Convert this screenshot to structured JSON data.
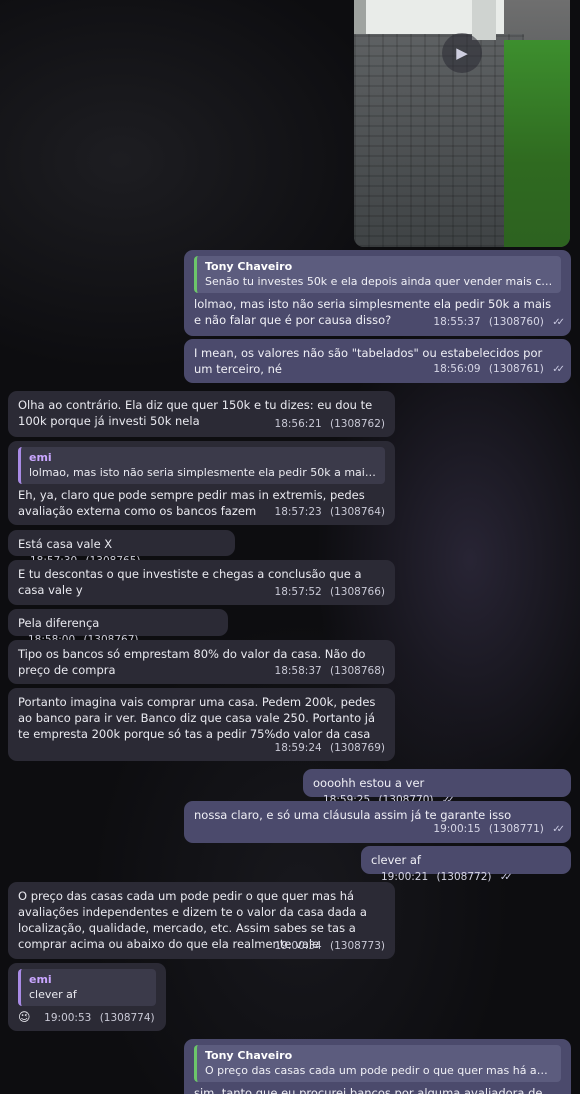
{
  "messages": [
    {
      "type": "out",
      "reply": {
        "author": "Tony Chaveiro",
        "text": "Senão tu investes 50k e ela depois ainda quer vender mais car..."
      },
      "text": "lolmao, mas isto não seria simplesmente ela pedir 50k a mais e não falar que é por causa disso?",
      "time": "18:55:37",
      "id": "(1308760)"
    },
    {
      "type": "out",
      "text": "I mean, os valores não são \"tabelados\" ou estabelecidos por um terceiro, né",
      "time": "18:56:09",
      "id": "(1308761)"
    },
    {
      "type": "in",
      "text": "Olha ao contrário. Ela diz que quer 150k e tu dizes: eu dou te 100k porque já investi 50k nela",
      "time": "18:56:21",
      "id": "(1308762)"
    },
    {
      "type": "in",
      "reply": {
        "author": "emi",
        "text": "lolmao, mas isto não seria simplesmente ela pedir 50k a mais e ..."
      },
      "text": "Eh, ya, claro que pode sempre pedir mas in extremis, pedes avaliação externa como os bancos fazem",
      "time": "18:57:23",
      "id": "(1308764)"
    },
    {
      "type": "in",
      "text": "Está casa vale X",
      "time": "18:57:30",
      "id": "(1308765)"
    },
    {
      "type": "in",
      "text": "E tu descontas o que investiste e chegas a conclusão que a casa vale y",
      "time": "18:57:52",
      "id": "(1308766)"
    },
    {
      "type": "in",
      "text": "Pela diferença",
      "time": "18:58:00",
      "id": "(1308767)"
    },
    {
      "type": "in",
      "text": "Tipo os bancos só emprestam 80% do valor da casa. Não do preço de compra",
      "time": "18:58:37",
      "id": "(1308768)"
    },
    {
      "type": "in",
      "text": "Portanto imagina vais comprar uma casa. Pedem 200k, pedes ao banco para ir ver. Banco diz que casa vale 250. Portanto já te empresta 200k porque só tas a pedir 75%do valor da casa",
      "time": "18:59:24",
      "id": "(1308769)"
    },
    {
      "type": "out",
      "text": "oooohh estou a ver",
      "time": "18:59:25",
      "id": "(1308770)"
    },
    {
      "type": "out",
      "text": "nossa claro, e só uma cláusula assim já te garante isso",
      "time": "19:00:15",
      "id": "(1308771)"
    },
    {
      "type": "out",
      "text": "clever af",
      "time": "19:00:21",
      "id": "(1308772)"
    },
    {
      "type": "in",
      "text": "O preço das casas cada um pode pedir o que quer mas há avaliações independentes e dizem te o valor da casa dada a localização, qualidade, mercado, etc. Assim sabes se tas a comprar acima ou abaixo do que ela realmente vale",
      "time": "19:00:34",
      "id": "(1308773)"
    },
    {
      "type": "in",
      "reply": {
        "author": "emi",
        "text": "clever af"
      },
      "text": "😉",
      "time": "19:00:53",
      "id": "(1308774)"
    },
    {
      "type": "out",
      "reply": {
        "author": "Tony Chaveiro",
        "text": "O preço das casas cada um pode pedir o que quer mas há avalia..."
      },
      "text": "sim, tanto que eu procurei bancos por alguma avaliadora de tipo",
      "time": "",
      "id": ""
    }
  ],
  "icons": {
    "play": "play-icon",
    "read": "double-check-icon"
  }
}
